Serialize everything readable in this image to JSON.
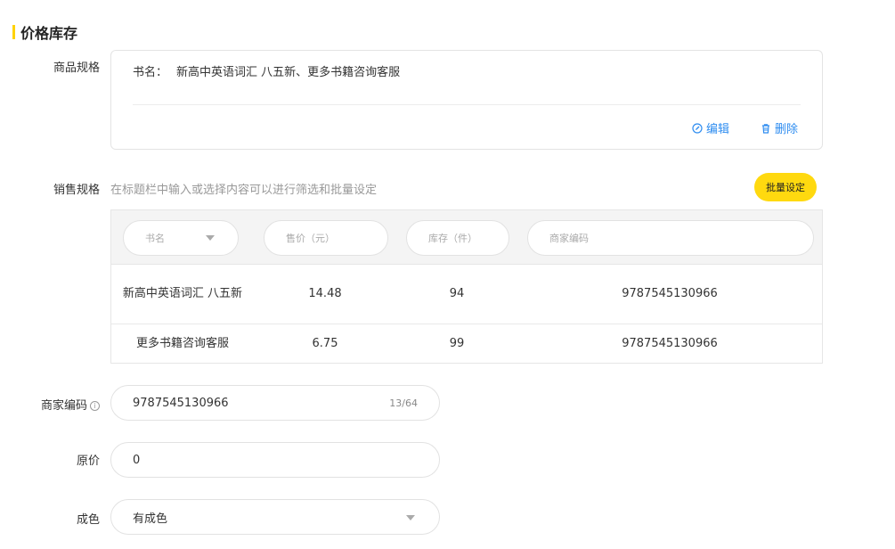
{
  "section": {
    "title": "价格库存"
  },
  "product_spec": {
    "label": "商品规格",
    "key": "书名：",
    "value": "新高中英语词汇 八五新、更多书籍咨询客服",
    "edit_label": "编辑",
    "delete_label": "删除"
  },
  "sales_spec": {
    "label": "销售规格",
    "hint": "在标题栏中输入或选择内容可以进行筛选和批量设定",
    "batch_button": "批量设定",
    "filters": {
      "book_name": "书名",
      "price": "售价（元）",
      "stock": "库存（件）",
      "merchant_code": "商家编码"
    },
    "rows": [
      {
        "name": "新高中英语词汇 八五新",
        "price": "14.48",
        "stock": "94",
        "code": "9787545130966"
      },
      {
        "name": "更多书籍咨询客服",
        "price": "6.75",
        "stock": "99",
        "code": "9787545130966"
      }
    ]
  },
  "merchant_code": {
    "label": "商家编码",
    "value": "9787545130966",
    "count": "13/64"
  },
  "original_price": {
    "label": "原价",
    "value": "0"
  },
  "condition": {
    "label": "成色",
    "value": "有成色"
  },
  "colors": {
    "accent": "#ffd90f",
    "link": "#2d8cf0"
  }
}
